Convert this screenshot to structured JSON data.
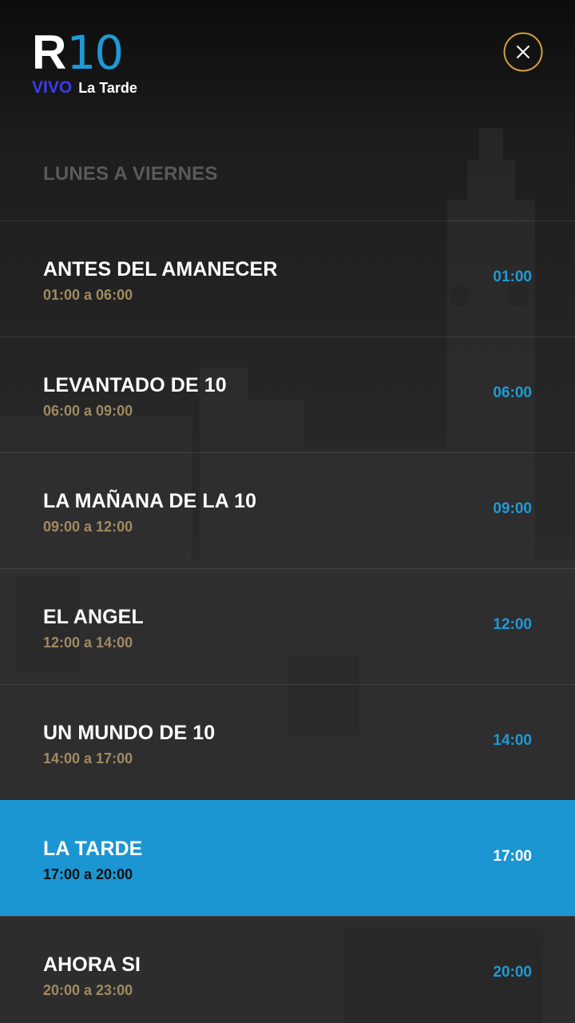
{
  "header": {
    "logo_r": "R",
    "logo_10": "10",
    "live_badge": "VIVO",
    "live_program": "La Tarde"
  },
  "colors": {
    "accent": "#1e9ad6",
    "active_row": "#1b96d2",
    "live_badge": "#3b3bf0",
    "time_range": "#a08a62",
    "close_ring": "#d4a040"
  },
  "icons": {
    "close": "close-icon"
  },
  "schedule": {
    "title": "LUNES A VIERNES",
    "items": [
      {
        "name": "ANTES DEL AMANECER",
        "range": "01:00 a 06:00",
        "time": "01:00",
        "active": false
      },
      {
        "name": "LEVANTADO DE 10",
        "range": "06:00 a 09:00",
        "time": "06:00",
        "active": false
      },
      {
        "name": "LA MAÑANA DE LA 10",
        "range": "09:00 a 12:00",
        "time": "09:00",
        "active": false
      },
      {
        "name": "EL ANGEL",
        "range": "12:00 a 14:00",
        "time": "12:00",
        "active": false
      },
      {
        "name": "UN MUNDO DE 10",
        "range": "14:00 a 17:00",
        "time": "14:00",
        "active": false
      },
      {
        "name": "LA TARDE",
        "range": "17:00 a 20:00",
        "time": "17:00",
        "active": true
      },
      {
        "name": "AHORA SI",
        "range": "20:00 a 23:00",
        "time": "20:00",
        "active": false
      }
    ]
  }
}
